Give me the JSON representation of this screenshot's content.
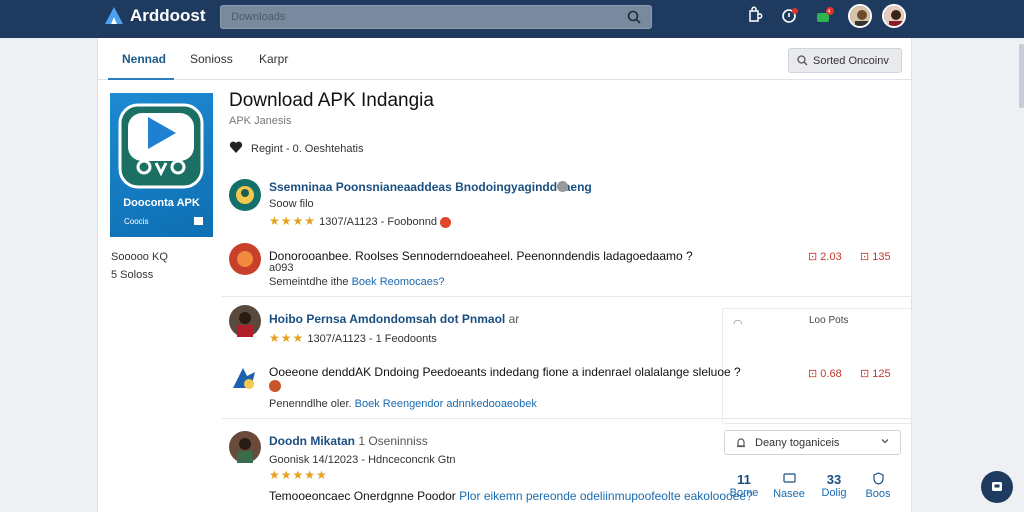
{
  "topbar": {
    "brand": "Arddoost",
    "search_placeholder": "Downloads"
  },
  "tabs": [
    {
      "label": "Nennad",
      "active": true
    },
    {
      "label": "Sonioss",
      "active": false
    },
    {
      "label": "Karpr",
      "active": false
    }
  ],
  "sort_button": "Sorted Oncoinv",
  "app": {
    "image_label": "Dooconta APK",
    "image_sub": "Coocis",
    "title": "Download APK Indangia",
    "subtitle": "APK Janesis",
    "meta": "Regint - 0. Oeshtehatis",
    "side_stats": [
      "Sooooo KQ",
      "5 Soloss"
    ]
  },
  "comments": [
    {
      "name": "Ssemninaa Poonsnianeaaddeas Bnodoingyaginddeaeng",
      "sub": "Soow filo",
      "rating_text": "1307/A1123 - Foobonnd",
      "stars": "★★★★"
    },
    {
      "text": "Donorooanbee. Roolses Sennoderndoeaheel. Peenonndendis ladagoedaamo ?",
      "sub_text": "a093",
      "link_prefix": "Semeintdhe ithe",
      "link": "Boek Reomocaes?",
      "votes_down": "2.03",
      "votes_up": "135"
    },
    {
      "name": "Hoibo Pernsa Amdondomsah dot Pnmaol",
      "name_suffix": "ar",
      "rating_text": "1307/A1123 - 1 Feodoonts",
      "stars": "★★★",
      "right_label": "Loo Pots"
    },
    {
      "text": "Ooeeone denddAK Dndoing Peedoeants indedang fione a indenrael olalalange sleluoe ?",
      "link_prefix": "Penenndlhe oler.",
      "link": "Boek Reengendor adnnkedooaeobek",
      "votes_down": "0.68",
      "votes_up": "125"
    },
    {
      "name": "Doodn Mikatan",
      "name_suffix": "1 Oseninniss",
      "line": "Goonisk 14/12023 - Hdnceconcnk",
      "line_tail": "Gtn",
      "stars": "★★★★★",
      "text": "Temooeoncaec Onerdgnne Poodor",
      "link": "Plor eikemn pereonde odeliinmupoofeolte eakoloooee?"
    }
  ],
  "filter": "Deany toganiceis",
  "stats": [
    {
      "n": "11",
      "label": "Bome"
    },
    {
      "n": "",
      "label": "Nasee"
    },
    {
      "n": "33",
      "label": "Dolig"
    },
    {
      "n": "",
      "label": "Boos"
    }
  ],
  "colors": {
    "topbar": "#1e3a5f",
    "accent": "#2e7fc1",
    "star": "#e6a21c",
    "vote": "#c0392b"
  }
}
